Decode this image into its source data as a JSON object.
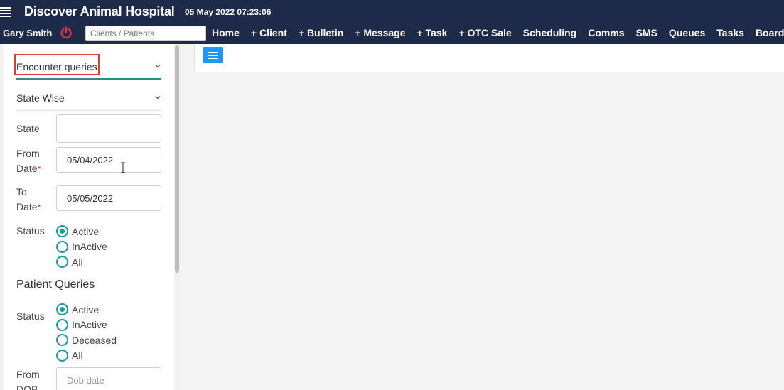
{
  "header": {
    "app_title": "Discover Animal Hospital",
    "datetime": "05 May 2022 07:23:06",
    "user_name": "Gary Smith",
    "search_placeholder": "Clients / Patients",
    "nav": [
      "Home",
      "+ Client",
      "+ Bulletin",
      "+ Message",
      "+ Task",
      "+ OTC Sale",
      "Scheduling",
      "Comms",
      "SMS",
      "Queues",
      "Tasks",
      "Boarding"
    ]
  },
  "sidebar": {
    "query_type": "Encounter queries",
    "filter_type": "State Wise",
    "state_label": "State",
    "state_value": "",
    "from_date_label": "From Date",
    "from_date_value": "05/04/2022",
    "to_date_label": "To Date",
    "to_date_value": "05/05/2022",
    "required_mark": "*",
    "status_label": "Status",
    "status_options": [
      "Active",
      "InActive",
      "All"
    ],
    "status_selected": "Active",
    "patient_section_title": "Patient Queries",
    "patient_status_label": "Status",
    "patient_status_options": [
      "Active",
      "InActive",
      "Deceased",
      "All"
    ],
    "patient_status_selected": "Active",
    "from_dob_label": "From DOB",
    "dob_placeholder": "Dob date"
  },
  "colors": {
    "header_bg": "#1d2a4a",
    "accent": "#1a9aa0",
    "menu_button": "#2196f3",
    "power_icon": "#e53935",
    "highlight": "#e53935"
  },
  "icons": {
    "menu": "hamburger-icon",
    "power": "power-icon",
    "dropdown": "chevron-down-icon",
    "cursor": "text-cursor-icon"
  }
}
